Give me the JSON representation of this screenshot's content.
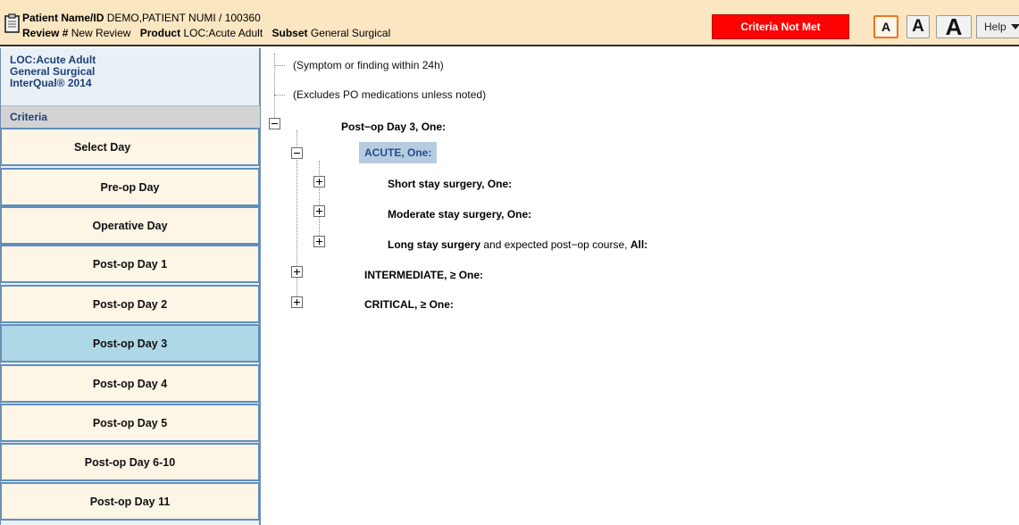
{
  "header": {
    "patient_label": "Patient Name/ID",
    "patient_value": "DEMO,PATIENT NUMI / 100360",
    "review_label": "Review #",
    "review_value": "New Review",
    "product_label": "Product",
    "product_value": "LOC:Acute Adult",
    "subset_label": "Subset",
    "subset_value": "General Surgical",
    "criteria_status": "Criteria Not Met",
    "status_color": "#ff0000",
    "font_small": "A",
    "font_medium": "A",
    "font_large": "A",
    "help_label": "Help"
  },
  "sidebar": {
    "info_line1": "LOC:Acute Adult",
    "info_line2": "General Surgical",
    "info_line3": "InterQual® 2014",
    "criteria_header": "Criteria",
    "items": [
      {
        "label": "Select Day"
      },
      {
        "label": "Pre-op Day"
      },
      {
        "label": "Operative Day"
      },
      {
        "label": "Post-op Day 1"
      },
      {
        "label": "Post-op Day 2"
      },
      {
        "label": "Post-op Day 3"
      },
      {
        "label": "Post-op Day 4"
      },
      {
        "label": "Post-op Day 5"
      },
      {
        "label": "Post-op Day 6-10"
      },
      {
        "label": "Post-op Day 11"
      }
    ],
    "selected_index": 5,
    "selected_color": "#afd8e6"
  },
  "tree": {
    "note1": "(Symptom or finding within 24h)",
    "note2": "(Excludes PO medications unless noted)",
    "root": "Post−op Day 3, One:",
    "acute": "ACUTE, One:",
    "short_stay": "Short stay surgery, One:",
    "moderate_stay": "Moderate stay surgery, One:",
    "long_stay_bold": "Long stay surgery",
    "long_stay_rest": " and expected post−op course, ",
    "long_stay_all": "All:",
    "intermediate": "INTERMEDIATE, ≥ One:",
    "critical": "CRITICAL, ≥ One:"
  }
}
